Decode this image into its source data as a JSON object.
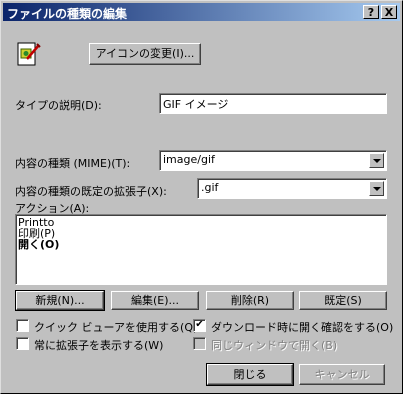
{
  "window": {
    "title": "ファイルの種類の編集",
    "help_glyph": "?",
    "close_glyph": "X"
  },
  "file_icon": {
    "icon": "gif-file-icon"
  },
  "change_icon_button": "アイコンの変更(I)...",
  "description": {
    "label": "タイプの説明(D):",
    "value": "GIF イメージ"
  },
  "mime": {
    "label": "内容の種類 (MIME)(T):",
    "value": "image/gif"
  },
  "extension": {
    "label": "内容の種類の既定の拡張子(X):",
    "value": ".gif"
  },
  "actions": {
    "label": "アクション(A):",
    "items": [
      "Printto",
      "印刷(P)",
      "開く(O)"
    ],
    "default_item": "開く(O)"
  },
  "action_buttons": {
    "new": "新規(N)...",
    "edit": "編集(E)...",
    "remove": "削除(R)",
    "set_default": "既定(S)"
  },
  "options": {
    "quick_view": {
      "label": "クイック ビューアを使用する(Q)",
      "checked": false,
      "enabled": true
    },
    "confirm_open": {
      "label": "ダウンロード時に開く確認をする(O)",
      "checked": true,
      "enabled": true
    },
    "show_extension": {
      "label": "常に拡張子を表示する(W)",
      "checked": false,
      "enabled": true
    },
    "same_window": {
      "label": "同じウィンドウで開く(B)",
      "checked": false,
      "enabled": false
    }
  },
  "footer": {
    "close": "閉じる",
    "cancel": "キャンセル"
  }
}
